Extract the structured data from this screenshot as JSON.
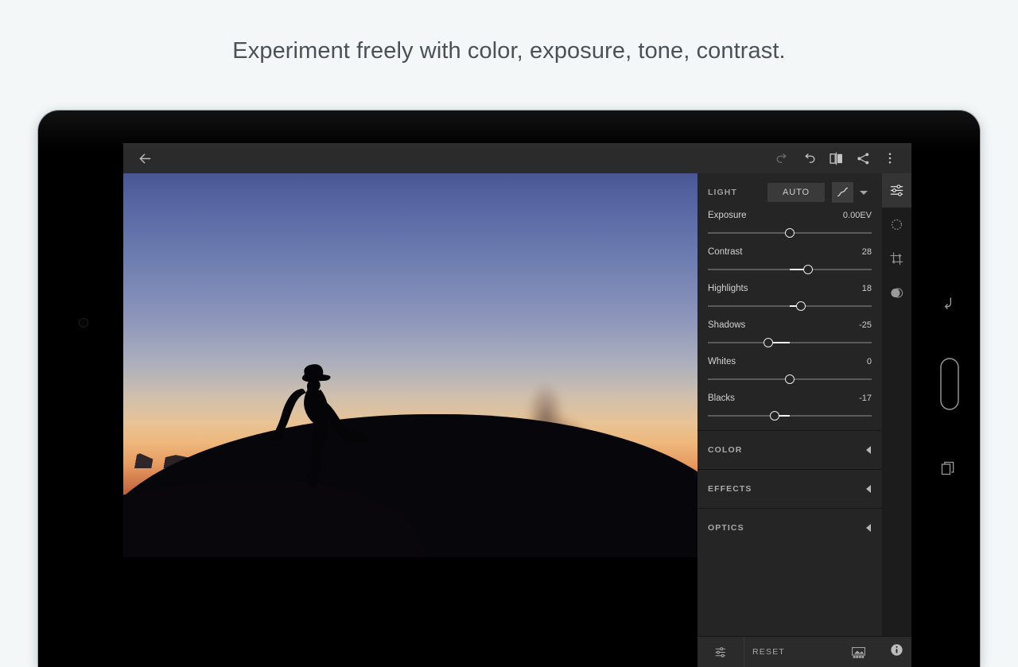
{
  "headline": "Experiment freely with color, exposure, tone, contrast.",
  "colors": {
    "page_background": "#f3f7f8",
    "panel_background": "#252525",
    "topbar_background": "#2b2b2b",
    "rail_background": "#1c1c1c",
    "accent_text": "#d2d2d2"
  },
  "topbar": {
    "back_icon": "back-arrow-icon",
    "actions": [
      {
        "icon": "redo-icon",
        "dimmed": true
      },
      {
        "icon": "undo-icon",
        "dimmed": false
      },
      {
        "icon": "before-after-compare-icon",
        "dimmed": false
      },
      {
        "icon": "share-icon",
        "dimmed": false
      },
      {
        "icon": "overflow-menu-icon",
        "dimmed": false
      }
    ]
  },
  "panel": {
    "light": {
      "title": "LIGHT",
      "auto_label": "AUTO",
      "curve_icon": "tone-curve-icon",
      "caret_icon": "chevron-down-icon",
      "sliders": [
        {
          "label": "Exposure",
          "value": "0.00EV",
          "pos": 50,
          "center": 50
        },
        {
          "label": "Contrast",
          "value": "28",
          "pos": 61,
          "center": 50
        },
        {
          "label": "Highlights",
          "value": "18",
          "pos": 57,
          "center": 50
        },
        {
          "label": "Shadows",
          "value": "-25",
          "pos": 37,
          "center": 50
        },
        {
          "label": "Whites",
          "value": "0",
          "pos": 50,
          "center": 50
        },
        {
          "label": "Blacks",
          "value": "-17",
          "pos": 41,
          "center": 50
        }
      ]
    },
    "collapsed_sections": [
      {
        "title": "COLOR",
        "arrow_icon": "chevron-left-icon"
      },
      {
        "title": "EFFECTS",
        "arrow_icon": "chevron-left-icon"
      },
      {
        "title": "OPTICS",
        "arrow_icon": "chevron-left-icon"
      }
    ]
  },
  "bottombar": {
    "edit_icon": "edit-sliders-icon",
    "reset_label": "RESET",
    "presets_icon": "presets-filmstrip-icon",
    "info_icon": "info-circle-icon"
  },
  "rail": {
    "items": [
      {
        "icon": "edit-sliders-icon",
        "active": true
      },
      {
        "icon": "selective-dot-circle-icon",
        "active": false
      },
      {
        "icon": "crop-rotate-icon",
        "active": false
      },
      {
        "icon": "healing-blend-icon",
        "active": false
      }
    ],
    "star_icon": "star-rating-icon"
  },
  "device": {
    "camera_icon": "front-camera-icon",
    "nav": [
      {
        "icon": "android-back-icon"
      },
      {
        "icon": "android-home-icon"
      },
      {
        "icon": "android-recents-icon"
      }
    ]
  },
  "photo": {
    "subject": "silhouette-of-person-kicking-dust-at-sunset"
  }
}
